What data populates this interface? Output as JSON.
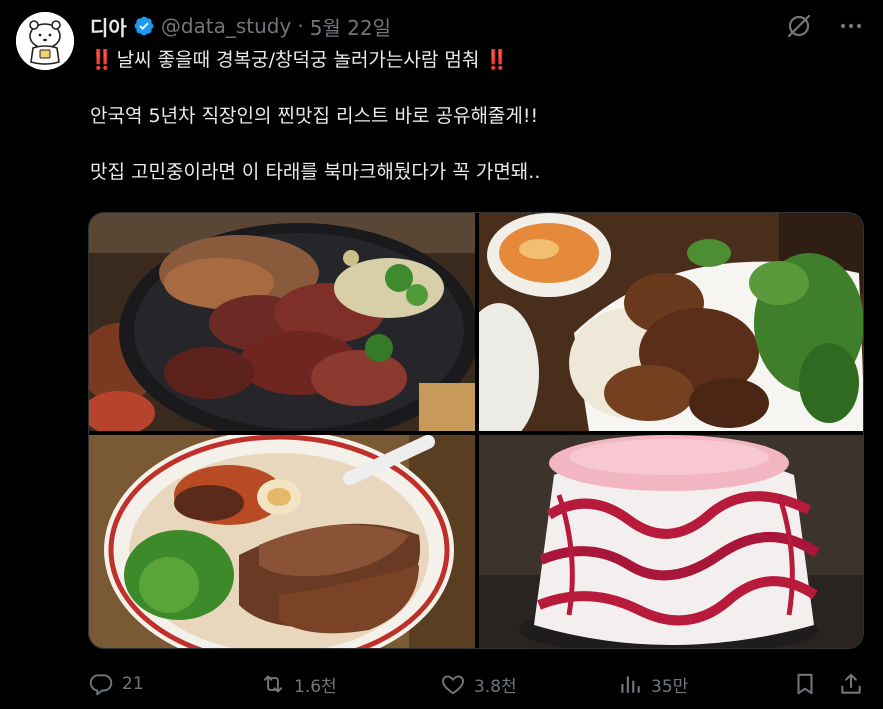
{
  "author": {
    "display_name": "디아",
    "handle": "@data_study",
    "separator": "·",
    "date": "5월 22일",
    "verified": true,
    "avatar_icon": "bear-avatar-icon"
  },
  "top_actions": [
    {
      "icon": "grok-icon"
    },
    {
      "icon": "more-icon"
    }
  ],
  "tweet": {
    "line1_prefix": "‼️",
    "line1_text": "날씨 좋을때 경복궁/창덕궁 놀러가는사람 멈춰",
    "line1_suffix": "‼️",
    "line2": "안국역 5년차 직장인의 찐맛집 리스트 바로 공유해줄게!!",
    "line3": "맛집 고민중이라면 이 타래를 북마크해뒀다가 꼭 가면돼.."
  },
  "media": [
    {
      "subject": "grilled-pork-and-beef-platter"
    },
    {
      "subject": "grilled-pork-rice-noodle-plate"
    },
    {
      "subject": "ramen-with-chashu"
    },
    {
      "subject": "strawberry-shaved-ice"
    }
  ],
  "actions": {
    "reply_count": "21",
    "retweet_count": "1.6천",
    "like_count": "3.8천",
    "view_count": "35만"
  },
  "colors": {
    "background": "#000000",
    "text_primary": "#e7e9ea",
    "text_secondary": "#71767b",
    "verified_blue": "#1d9bf0",
    "exclamation_red": "#e0242f"
  }
}
